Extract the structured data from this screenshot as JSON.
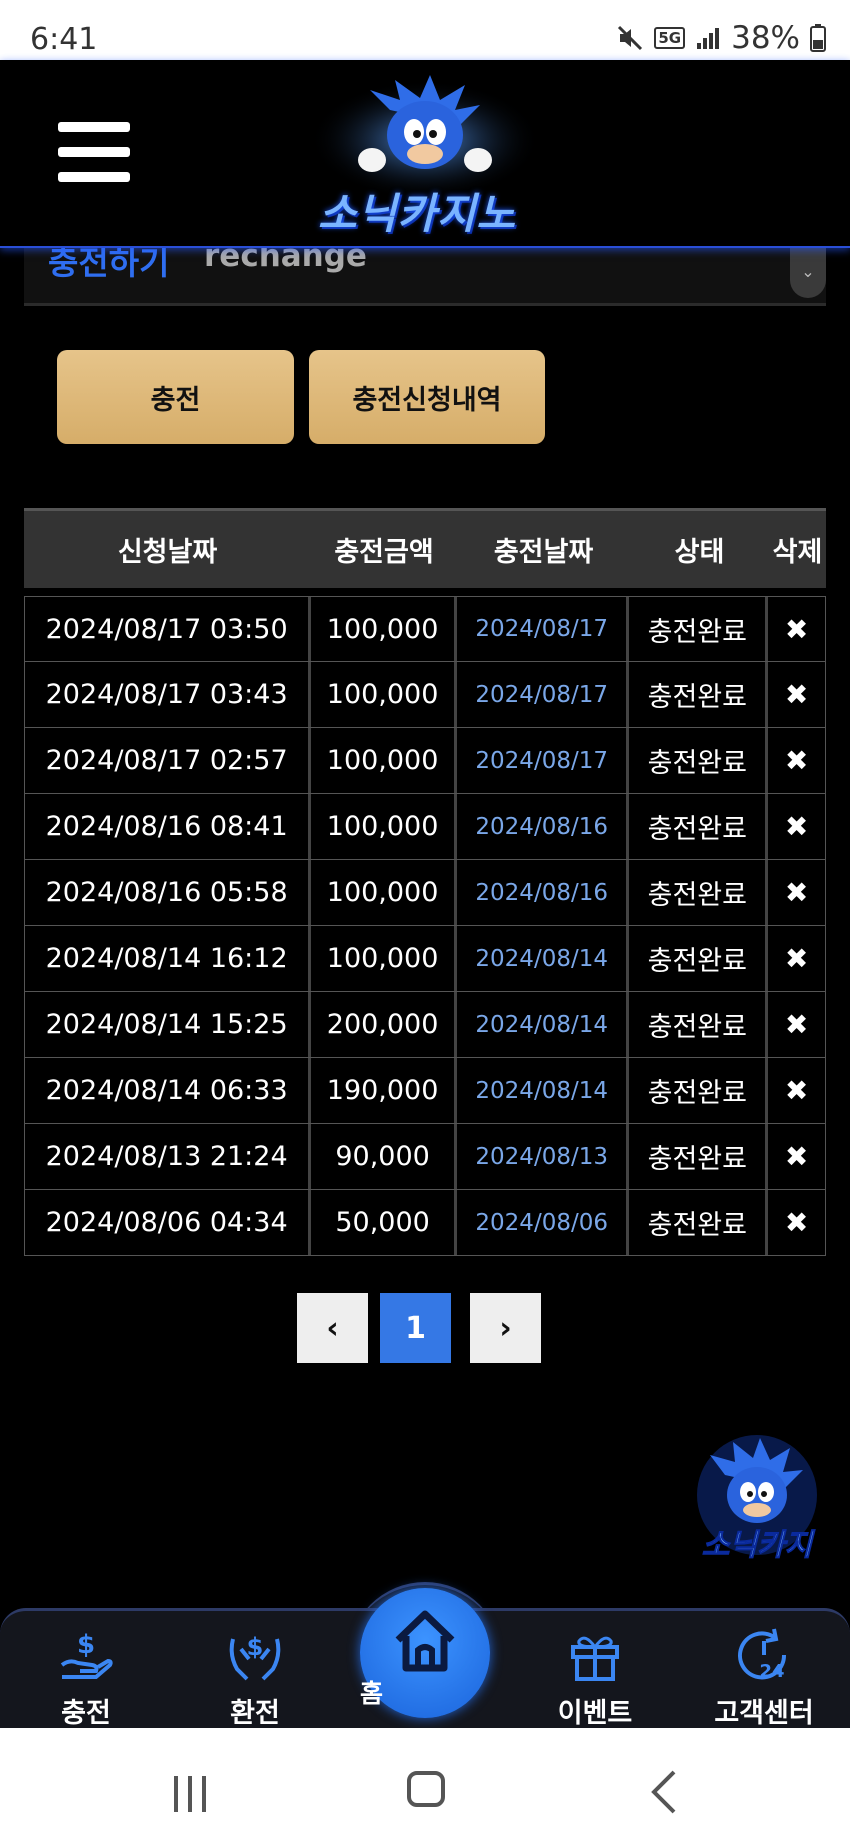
{
  "status_bar": {
    "time": "6:41",
    "network": "5G",
    "battery": "38%"
  },
  "header": {
    "logo_text": "소닉카지노"
  },
  "section": {
    "title_ko": "충전하기",
    "title_en": "rechange"
  },
  "buttons": {
    "charge": "충전",
    "history": "충전신청내역"
  },
  "table": {
    "headers": [
      "신청날짜",
      "충전금액",
      "충전날짜",
      "상태",
      "삭제"
    ],
    "rows": [
      {
        "request_date": "2024/08/17 03:50",
        "amount": "100,000",
        "charge_date": "2024/08/17",
        "status": "충전완료",
        "delete": "✖"
      },
      {
        "request_date": "2024/08/17 03:43",
        "amount": "100,000",
        "charge_date": "2024/08/17",
        "status": "충전완료",
        "delete": "✖"
      },
      {
        "request_date": "2024/08/17 02:57",
        "amount": "100,000",
        "charge_date": "2024/08/17",
        "status": "충전완료",
        "delete": "✖"
      },
      {
        "request_date": "2024/08/16 08:41",
        "amount": "100,000",
        "charge_date": "2024/08/16",
        "status": "충전완료",
        "delete": "✖"
      },
      {
        "request_date": "2024/08/16 05:58",
        "amount": "100,000",
        "charge_date": "2024/08/16",
        "status": "충전완료",
        "delete": "✖"
      },
      {
        "request_date": "2024/08/14 16:12",
        "amount": "100,000",
        "charge_date": "2024/08/14",
        "status": "충전완료",
        "delete": "✖"
      },
      {
        "request_date": "2024/08/14 15:25",
        "amount": "200,000",
        "charge_date": "2024/08/14",
        "status": "충전완료",
        "delete": "✖"
      },
      {
        "request_date": "2024/08/14 06:33",
        "amount": "190,000",
        "charge_date": "2024/08/14",
        "status": "충전완료",
        "delete": "✖"
      },
      {
        "request_date": "2024/08/13 21:24",
        "amount": "90,000",
        "charge_date": "2024/08/13",
        "status": "충전완료",
        "delete": "✖"
      },
      {
        "request_date": "2024/08/06 04:34",
        "amount": "50,000",
        "charge_date": "2024/08/06",
        "status": "충전완료",
        "delete": "✖"
      }
    ]
  },
  "pagination": {
    "prev": "‹",
    "current": "1",
    "next": "›"
  },
  "floating": {
    "mascot_text": "소닉카지"
  },
  "bottom_nav": {
    "charge": "충전",
    "exchange": "환전",
    "home": "홈",
    "event": "이벤트",
    "support": "고객센터",
    "support_badge": "24"
  },
  "colors": {
    "accent_blue": "#3578e5",
    "gold": "#e0bb7b",
    "link_blue": "#7aa7e8"
  }
}
